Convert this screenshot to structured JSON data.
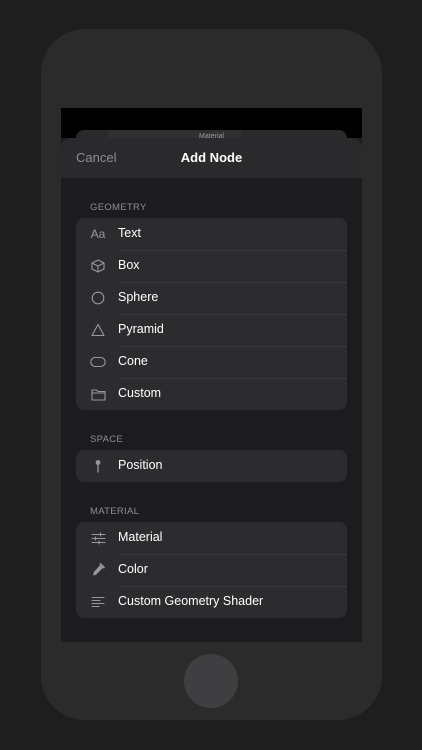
{
  "behind_sheet": {
    "title": "Material"
  },
  "nav": {
    "cancel": "Cancel",
    "title": "Add Node"
  },
  "sections": {
    "geometry": {
      "header": "GEOMETRY",
      "items": [
        {
          "label": "Text",
          "icon": "text-aa-icon",
          "icon_text": "Aa"
        },
        {
          "label": "Box",
          "icon": "cube-icon"
        },
        {
          "label": "Sphere",
          "icon": "circle-icon"
        },
        {
          "label": "Pyramid",
          "icon": "triangle-icon"
        },
        {
          "label": "Cone",
          "icon": "capsule-icon"
        },
        {
          "label": "Custom",
          "icon": "folder-icon"
        }
      ]
    },
    "space": {
      "header": "SPACE",
      "items": [
        {
          "label": "Position",
          "icon": "pin-icon"
        }
      ]
    },
    "material": {
      "header": "MATERIAL",
      "items": [
        {
          "label": "Material",
          "icon": "sliders-icon"
        },
        {
          "label": "Color",
          "icon": "eyedropper-icon"
        },
        {
          "label": "Custom Geometry Shader",
          "icon": "text-lines-icon"
        }
      ]
    }
  },
  "colors": {
    "background": "#1c1c1e",
    "group_background": "#2c2c2e",
    "text": "#ffffff",
    "secondary_text": "#8e8e93"
  }
}
